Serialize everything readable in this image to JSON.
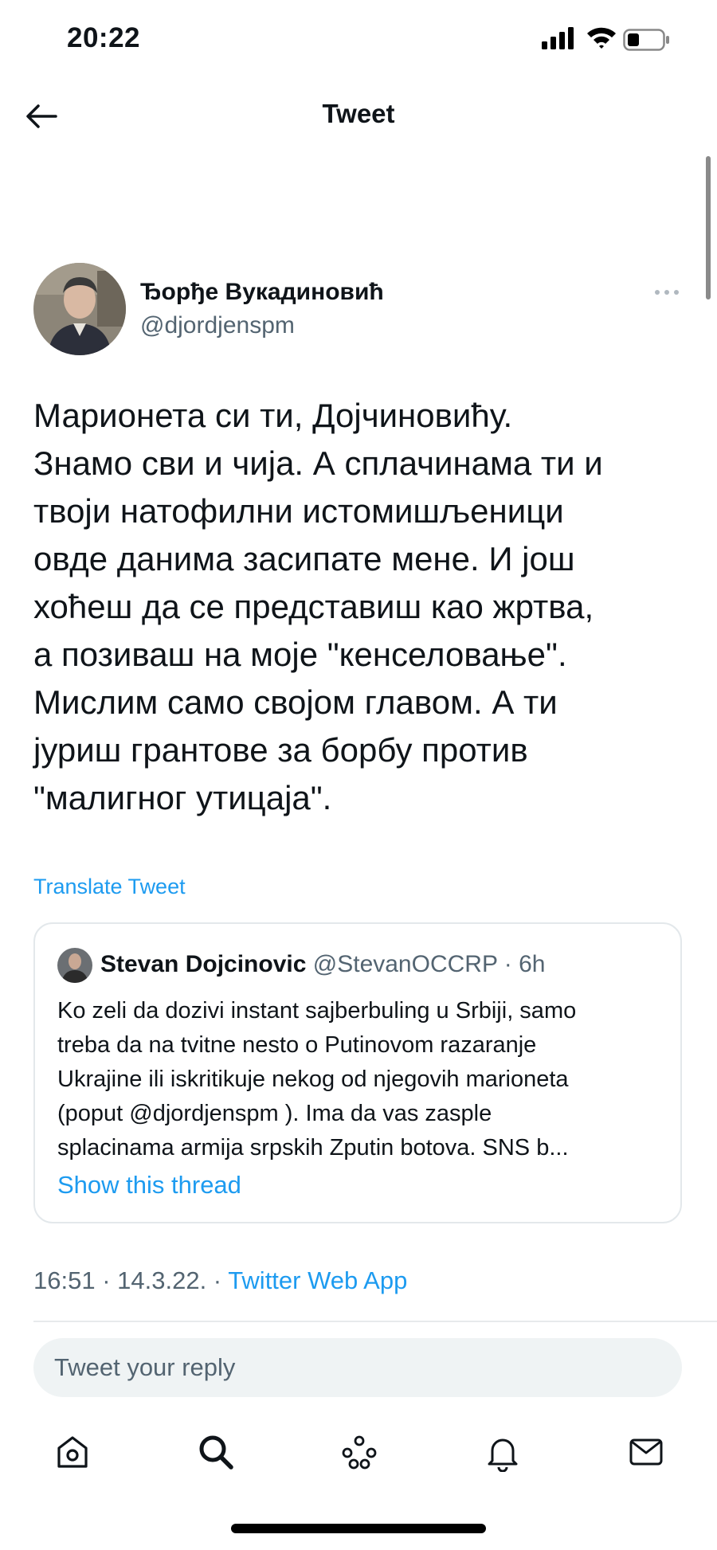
{
  "status_bar": {
    "time": "20:22"
  },
  "header": {
    "title": "Tweet"
  },
  "tweet": {
    "author_name": "Ђорђе Вукадиновић",
    "author_handle": "@djordjenspm",
    "text": "Марионета си ти, Дојчиновићу.\nЗнамо сви и чија. А сплачинама ти и\nтвоји натофилни истомишљеници\nовде данима засипате мене. И још\nхоћеш да се представиш као жртва,\nа позиваш на моје \"кенселовање\".\nМислим само својом главом. А ти\nјуриш грантове за борбу против\n\"малигног утицаја\".",
    "translate_label": "Translate Tweet",
    "time": "16:51",
    "date": "14.3.22.",
    "source": "Twitter Web App"
  },
  "quoted": {
    "name": "Stevan Dojcinovic",
    "handle": "@StevanOCCRP",
    "age": "6h",
    "text": "Ko zeli da dozivi instant sajberbuling u Srbiji, samo\ntreba da na tvitne nesto o Putinovom razaranje\nUkrajine ili iskritikuje nekog od njegovih marioneta\n(poput @djordjenspm ). Ima da vas zasple\nsplacinama armija srpskih Zputin botova. SNS b...",
    "show_thread": "Show this thread"
  },
  "reply": {
    "placeholder": "Tweet your reply"
  },
  "colors": {
    "accent": "#1d9bf0",
    "secondary_text": "#536471",
    "text": "#0f1419"
  },
  "nav": {
    "icons": [
      "home-icon",
      "search-icon",
      "spaces-icon",
      "notifications-icon",
      "messages-icon"
    ]
  }
}
